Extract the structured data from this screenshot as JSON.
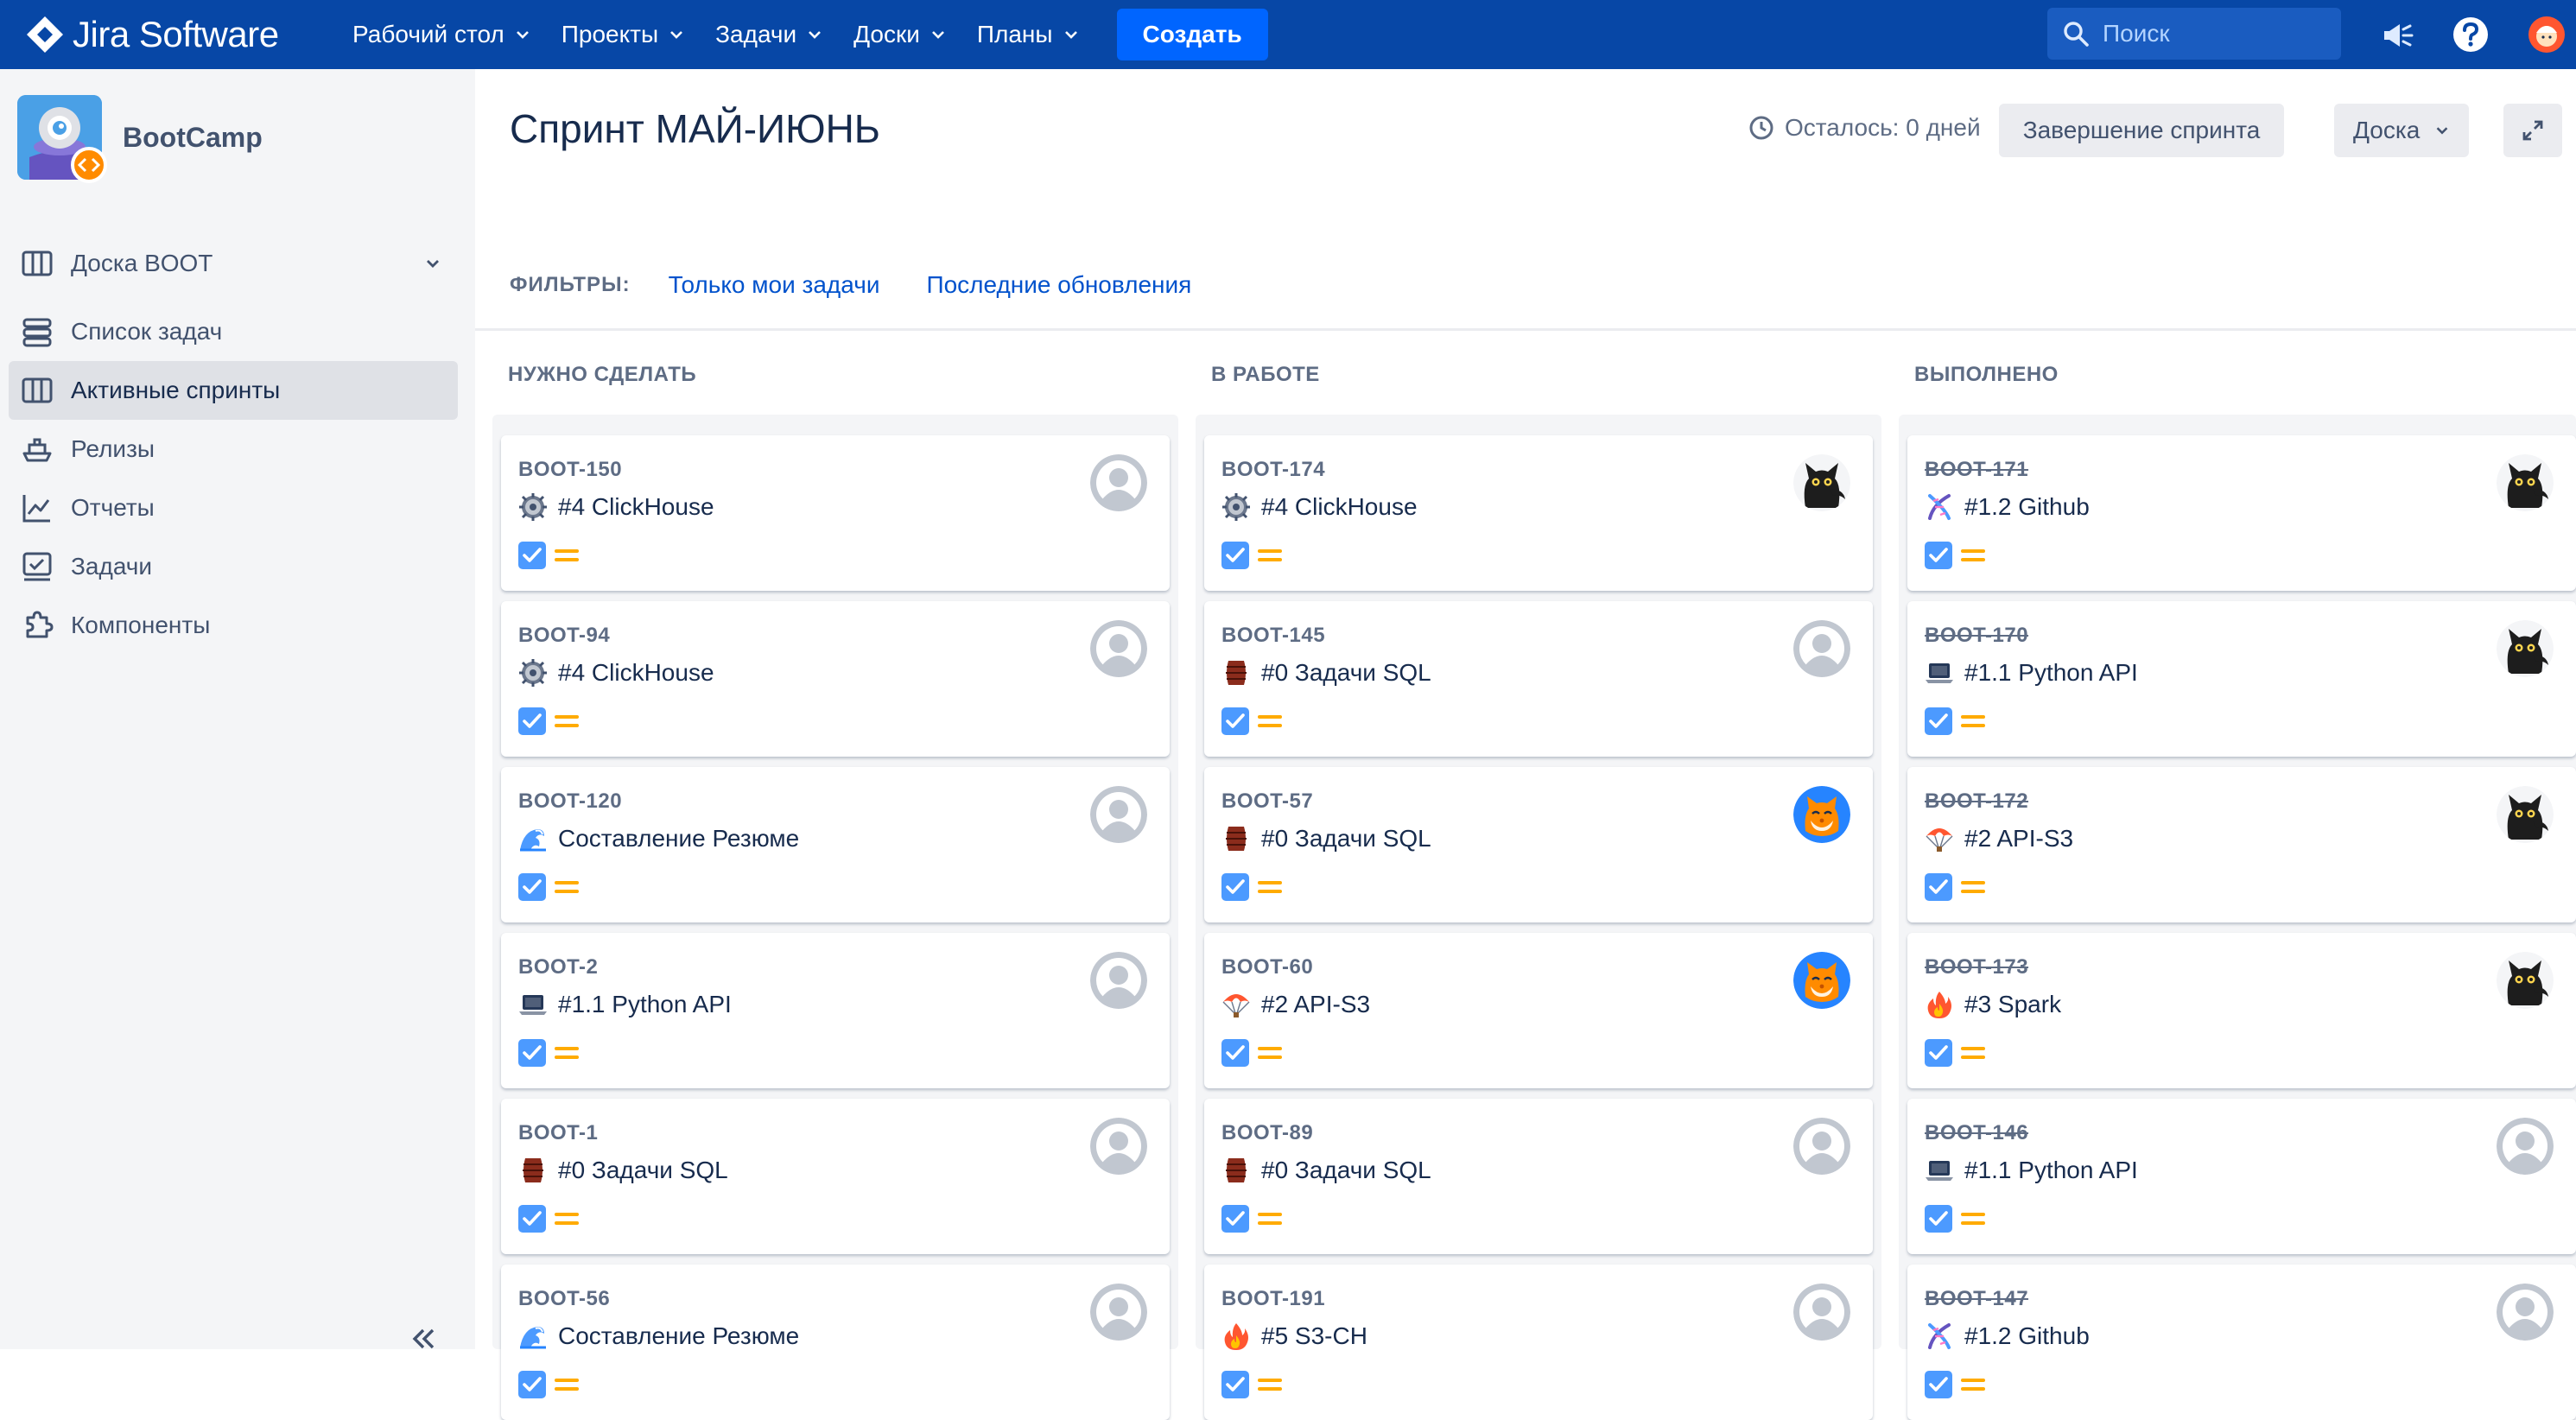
{
  "app": {
    "logo_text": "Jira Software"
  },
  "topnav": {
    "items": [
      {
        "label": "Рабочий стол"
      },
      {
        "label": "Проекты"
      },
      {
        "label": "Задачи"
      },
      {
        "label": "Доски"
      },
      {
        "label": "Планы"
      }
    ],
    "create_label": "Создать",
    "search_placeholder": "Поиск"
  },
  "sidebar": {
    "project_name": "BootCamp",
    "board_label": "Доска BOOT",
    "items": [
      {
        "label": "Список задач",
        "icon": "backlog-icon"
      },
      {
        "label": "Активные спринты",
        "icon": "board-icon",
        "active": true
      },
      {
        "label": "Релизы",
        "icon": "ship-icon"
      },
      {
        "label": "Отчеты",
        "icon": "chart-icon"
      },
      {
        "label": "Задачи",
        "icon": "issues-icon"
      },
      {
        "label": "Компоненты",
        "icon": "puzzle-icon"
      }
    ]
  },
  "header": {
    "title": "Спринт МАЙ-ИЮНЬ",
    "time_left": "Осталось: 0 дней",
    "complete_sprint": "Завершение спринта",
    "board_select": "Доска"
  },
  "filters": {
    "label": "ФИЛЬТРЫ:",
    "links": [
      "Только мои задачи",
      "Последние обновления"
    ]
  },
  "colors": {
    "nav_bg": "#0747a6",
    "create_btn": "#0065ff",
    "link": "#0052cc",
    "check": "#4c9aff",
    "priority_medium": "#ffab00"
  },
  "columns": [
    {
      "title": "НУЖНО СДЕЛАТЬ",
      "cards": [
        {
          "key": "BOOT-150",
          "emoji": "gear-icon",
          "summary": "#4 ClickHouse",
          "avatar": "default"
        },
        {
          "key": "BOOT-94",
          "emoji": "gear-icon",
          "summary": "#4 ClickHouse",
          "avatar": "default"
        },
        {
          "key": "BOOT-120",
          "emoji": "wave-icon",
          "summary": "Составление Резюме",
          "avatar": "default"
        },
        {
          "key": "BOOT-2",
          "emoji": "laptop-icon",
          "summary": "#1.1 Python API",
          "avatar": "default"
        },
        {
          "key": "BOOT-1",
          "emoji": "barrel-icon",
          "summary": "#0 Задачи SQL",
          "avatar": "default"
        },
        {
          "key": "BOOT-56",
          "emoji": "wave-icon",
          "summary": "Составление Резюме",
          "avatar": "default"
        }
      ]
    },
    {
      "title": "В РАБОТЕ",
      "cards": [
        {
          "key": "BOOT-174",
          "emoji": "gear-icon",
          "summary": "#4 ClickHouse",
          "avatar": "black-cat"
        },
        {
          "key": "BOOT-145",
          "emoji": "barrel-icon",
          "summary": "#0 Задачи SQL",
          "avatar": "default"
        },
        {
          "key": "BOOT-57",
          "emoji": "barrel-icon",
          "summary": "#0 Задачи SQL",
          "avatar": "ginger-cat"
        },
        {
          "key": "BOOT-60",
          "emoji": "parachute-icon",
          "summary": "#2 API-S3",
          "avatar": "ginger-cat"
        },
        {
          "key": "BOOT-89",
          "emoji": "barrel-icon",
          "summary": "#0 Задачи SQL",
          "avatar": "default"
        },
        {
          "key": "BOOT-191",
          "emoji": "fire-icon",
          "summary": "#5 S3-CH",
          "avatar": "default"
        }
      ]
    },
    {
      "title": "ВЫПОЛНЕНО",
      "cards": [
        {
          "key": "BOOT-171",
          "emoji": "dna-icon",
          "summary": "#1.2 Github",
          "avatar": "black-cat",
          "done": true
        },
        {
          "key": "BOOT-170",
          "emoji": "laptop-icon",
          "summary": "#1.1 Python API",
          "avatar": "black-cat",
          "done": true
        },
        {
          "key": "BOOT-172",
          "emoji": "parachute-icon",
          "summary": "#2 API-S3",
          "avatar": "black-cat",
          "done": true
        },
        {
          "key": "BOOT-173",
          "emoji": "fire-icon",
          "summary": "#3 Spark",
          "avatar": "black-cat",
          "done": true
        },
        {
          "key": "BOOT-146",
          "emoji": "laptop-icon",
          "summary": "#1.1 Python API",
          "avatar": "default",
          "done": true
        },
        {
          "key": "BOOT-147",
          "emoji": "dna-icon",
          "summary": "#1.2 Github",
          "avatar": "default",
          "done": true
        }
      ]
    }
  ]
}
